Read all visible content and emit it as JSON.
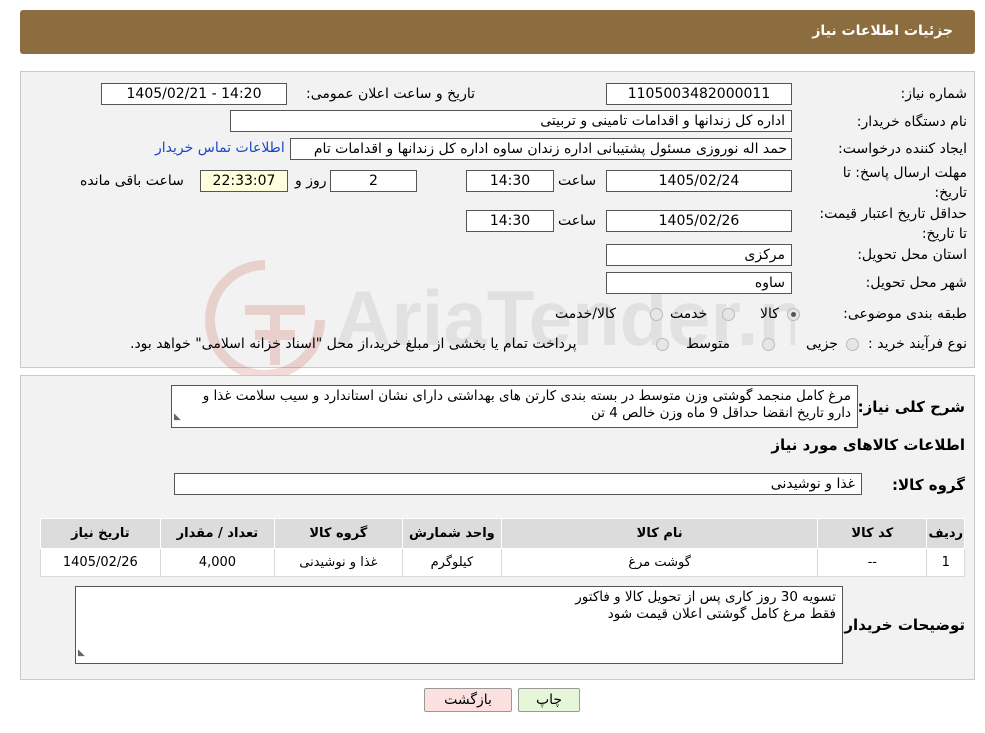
{
  "header": {
    "title": "جزئیات اطلاعات نیاز"
  },
  "form": {
    "need_number_label": "شماره نیاز:",
    "need_number": "1105003482000011",
    "announce_label": "تاریخ و ساعت اعلان عمومی:",
    "announce_value": "1405/02/21 - 14:20",
    "buyer_org_label": "نام دستگاه خریدار:",
    "buyer_org": "اداره کل زندانها و اقدامات تامینی و تربیتی",
    "requester_label": "ایجاد کننده درخواست:",
    "requester": "حمد اله نوروزی مسئول پشتیبانی اداره زندان ساوه اداره کل زندانها و اقدامات تام",
    "contact_link": "اطلاعات تماس خریدار",
    "deadline_label": "مهلت ارسال پاسخ: تا تاریخ:",
    "deadline_date": "1405/02/24",
    "time_label": "ساعت",
    "deadline_time": "14:30",
    "days_value": "2",
    "days_label": "روز و",
    "remaining_time": "22:33:07",
    "remaining_label": "ساعت باقی مانده",
    "validity_label": "حداقل تاریخ اعتبار قیمت: تا تاریخ:",
    "validity_date": "1405/02/26",
    "validity_time": "14:30",
    "province_label": "استان محل تحویل:",
    "province": "مرکزی",
    "city_label": "شهر محل تحویل:",
    "city": "ساوه",
    "category_label": "طبقه بندی موضوعی:",
    "category_options": [
      "کالا",
      "خدمت",
      "کالا/خدمت"
    ],
    "category_selected": "کالا",
    "process_label": "نوع فرآیند خرید :",
    "process_options": [
      "جزیی",
      "متوسط"
    ],
    "process_note": "پرداخت تمام یا بخشی از مبلغ خرید،از محل \"اسناد خزانه اسلامی\" خواهد بود."
  },
  "summary": {
    "label": "شرح کلی نیاز:",
    "text": "مرغ کامل منجمد گوشتی  وزن متوسط در بسته بندی  کارتن های بهداشتی دارای نشان استاندارد و سیب سلامت غذا و دارو تاریخ انقضا حداقل 9 ماه  وزن خالص 4 تن",
    "items_heading": "اطلاعات کالاهای مورد نیاز",
    "group_label": "گروه کالا:",
    "group_value": "غذا و نوشیدنی"
  },
  "table": {
    "headers": [
      "ردیف",
      "کد کالا",
      "نام کالا",
      "واحد شمارش",
      "گروه کالا",
      "تعداد / مقدار",
      "تاریخ نیاز"
    ],
    "rows": [
      [
        "1",
        "--",
        "گوشت مرغ",
        "کیلوگرم",
        "غذا و نوشیدنی",
        "4,000",
        "1405/02/26"
      ]
    ]
  },
  "buyer_notes": {
    "label": "توضیحات خریدار:",
    "line1": "تسویه 30 روز کاری پس از تحویل کالا و فاکتور",
    "line2": "فقط مرغ کامل گوشتی اعلان قیمت شود"
  },
  "buttons": {
    "print": "چاپ",
    "back": "بازگشت"
  },
  "watermark": {
    "text": "AriaTender.neT"
  },
  "colors": {
    "header": "#8c6d3f",
    "link": "#1a48c4",
    "print_button": "#e6f7d9",
    "back_button": "#fbe0df"
  }
}
